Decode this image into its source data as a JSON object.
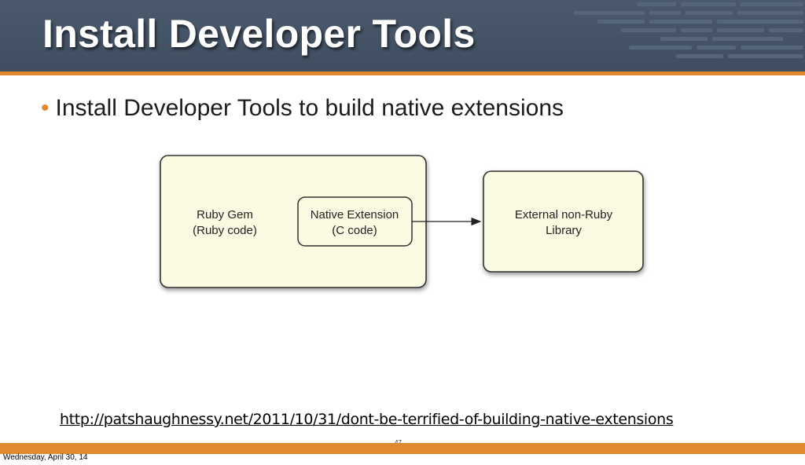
{
  "slide": {
    "title": "Install Developer Tools",
    "bullet_marker": "•",
    "bullet_text": "Install Developer Tools to build native extensions",
    "diagram": {
      "gem_box_line1": "Ruby Gem",
      "gem_box_line2": "(Ruby code)",
      "native_box_line1": "Native Extension",
      "native_box_line2": "(C code)",
      "library_box_line1": "External non-Ruby",
      "library_box_line2": "Library"
    },
    "url": "http://patshaughnessy.net/2011/10/31/dont-be-terrified-of-building-native-extensions",
    "page_number": "47"
  },
  "footer": {
    "date": "Wednesday, April 30, 14"
  },
  "colors": {
    "header": "#44546a",
    "accent": "#e2892f",
    "box_fill": "#fafbe2"
  }
}
